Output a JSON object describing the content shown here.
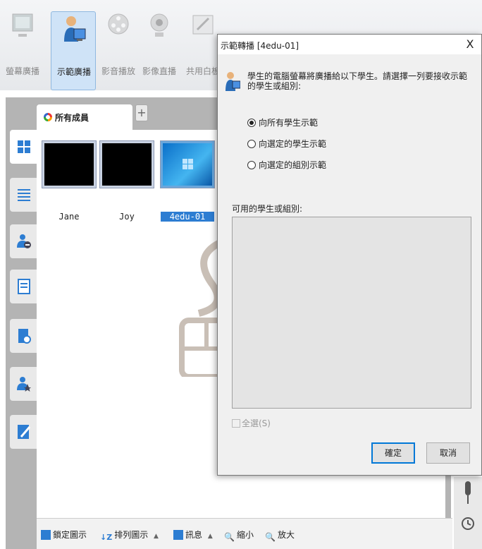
{
  "toolbar": {
    "items": [
      {
        "label": "螢幕廣播",
        "icon": "monitor-icon",
        "active": false
      },
      {
        "label": "示範廣播",
        "icon": "teacher-demo-icon",
        "active": true
      },
      {
        "label": "影音播放",
        "icon": "film-reel-icon",
        "active": false
      },
      {
        "label": "影像直播",
        "icon": "webcam-icon",
        "active": false
      },
      {
        "label": "共用白板",
        "icon": "whiteboard-icon",
        "active": false
      }
    ]
  },
  "members_panel": {
    "tab_label": "所有成員",
    "add_tab_glyph": "+",
    "students": [
      {
        "name": "Jane",
        "selected": false
      },
      {
        "name": "Joy",
        "selected": false
      },
      {
        "name": "4edu-01",
        "selected": true
      }
    ],
    "side_buttons": [
      "thumbnail-view-icon",
      "list-view-icon",
      "student-remove-icon",
      "document-icon",
      "file-clock-icon",
      "student-star-icon",
      "edit-pen-icon"
    ]
  },
  "bottombar": {
    "lock_label": "鎖定圖示",
    "sort_label": "排列圖示",
    "info_label": "訊息",
    "zoom_out_label": "縮小",
    "zoom_in_label": "放大",
    "caret": "▲"
  },
  "dialog": {
    "title": "示範轉播 [4edu-01]",
    "close_glyph": "X",
    "message": "學生的電腦螢幕將廣播給以下學生。請選擇一列要接收示範的學生或組別:",
    "options": [
      {
        "label": "向所有學生示範",
        "checked": true
      },
      {
        "label": "向選定的學生示範",
        "checked": false
      },
      {
        "label": "向選定的組別示範",
        "checked": false
      }
    ],
    "available_label": "可用的學生或組別:",
    "select_all_label": "全選(S)",
    "ok_label": "確定",
    "cancel_label": "取消"
  },
  "colors": {
    "accent": "#2d7dd2",
    "panel_bg": "#b4b4b4",
    "dialog_bg": "#f0f0f0"
  }
}
